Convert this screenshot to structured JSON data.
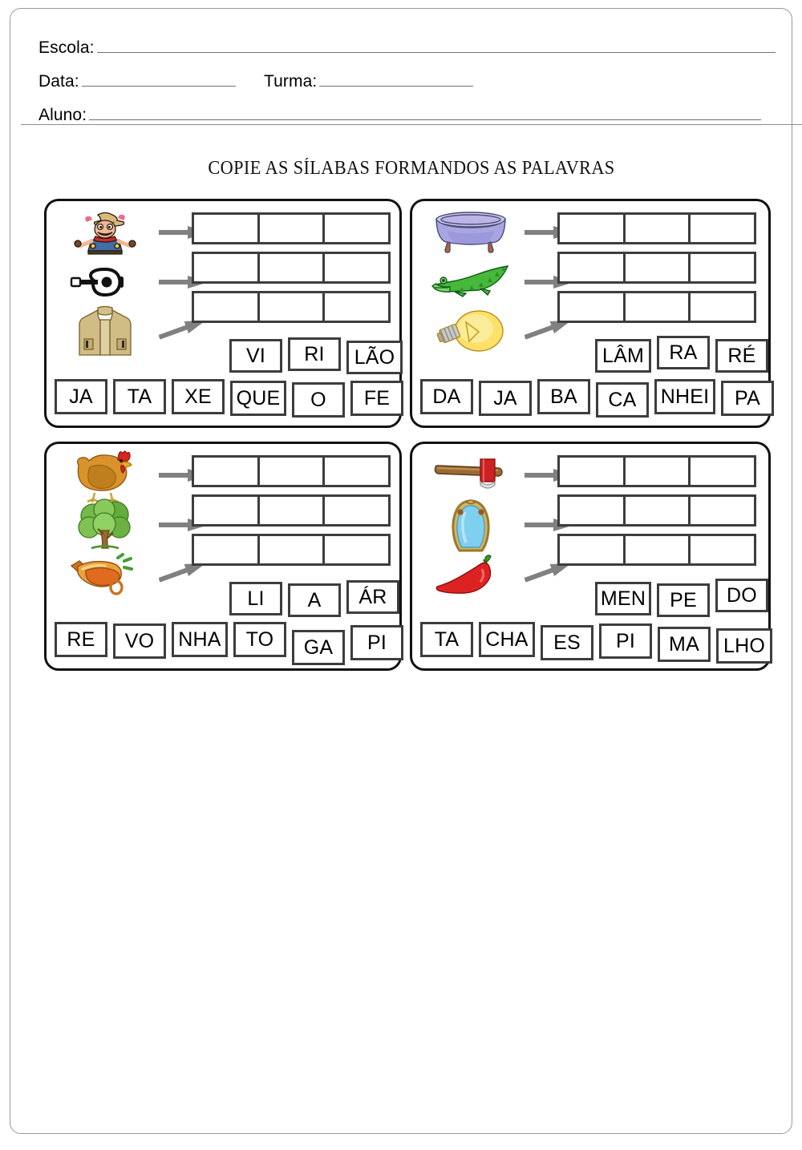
{
  "header": {
    "fields": [
      {
        "label": "Escola:",
        "value": "",
        "line_width": 846
      },
      {
        "label": "Data:",
        "value": "",
        "line_width": 192
      },
      {
        "label": "Turma:",
        "value": "",
        "line_width": 192
      },
      {
        "label": "Aluno:",
        "value": "",
        "line_width": 838
      }
    ]
  },
  "title": "COPIE AS SÍLABAS FORMANDOS  AS  PALAVRAS",
  "colors": {
    "page_border": "#9a9a9a",
    "box_border": "#111111",
    "cell_border": "#3d3d3d",
    "arrow": "#808080",
    "text": "#000000"
  },
  "exercises": [
    {
      "id": "exercise-1",
      "pictures": [
        {
          "icon": "cowboy-sheriff-icon",
          "answer": "XERIFE"
        },
        {
          "icon": "guitar-icon",
          "answer": "VIOLÃO"
        },
        {
          "icon": "vest-icon",
          "answer": "JAQUETA"
        }
      ],
      "answer_rows": 3,
      "answer_cols": 3,
      "tiles_upper": [
        "VI",
        "RI",
        "LÃO"
      ],
      "tiles_lower": [
        "JA",
        "TA",
        "XE",
        "QUE",
        "O",
        "FE"
      ]
    },
    {
      "id": "exercise-2",
      "pictures": [
        {
          "icon": "bathtub-icon",
          "answer": "BANHEIRA"
        },
        {
          "icon": "alligator-icon",
          "answer": "JACARÉ"
        },
        {
          "icon": "lightbulb-icon",
          "answer": "LÂMPADA"
        }
      ],
      "answer_rows": 3,
      "answer_cols": 3,
      "tiles_upper": [
        "LÂM",
        "RA",
        "RÉ"
      ],
      "tiles_lower": [
        "DA",
        "JA",
        "BA",
        "CA",
        "NHEI",
        "PA"
      ]
    },
    {
      "id": "exercise-3",
      "pictures": [
        {
          "icon": "hen-icon",
          "answer": "GALINHA"
        },
        {
          "icon": "tree-icon",
          "answer": "ÁRVORE"
        },
        {
          "icon": "whistle-icon",
          "answer": "APITO"
        }
      ],
      "answer_rows": 3,
      "answer_cols": 3,
      "tiles_upper": [
        "LI",
        "A",
        "ÁR"
      ],
      "tiles_lower": [
        "RE",
        "VO",
        "NHA",
        "TO",
        "GA",
        "PI"
      ]
    },
    {
      "id": "exercise-4",
      "pictures": [
        {
          "icon": "axe-icon",
          "answer": "MACHADO"
        },
        {
          "icon": "mirror-icon",
          "answer": "ESPELHO"
        },
        {
          "icon": "chili-pepper-icon",
          "answer": "PIMENTA"
        }
      ],
      "answer_rows": 3,
      "answer_cols": 3,
      "tiles_upper": [
        "MEN",
        "PE",
        "DO"
      ],
      "tiles_lower": [
        "TA",
        "CHA",
        "ES",
        "PI",
        "MA",
        "LHO"
      ]
    }
  ]
}
